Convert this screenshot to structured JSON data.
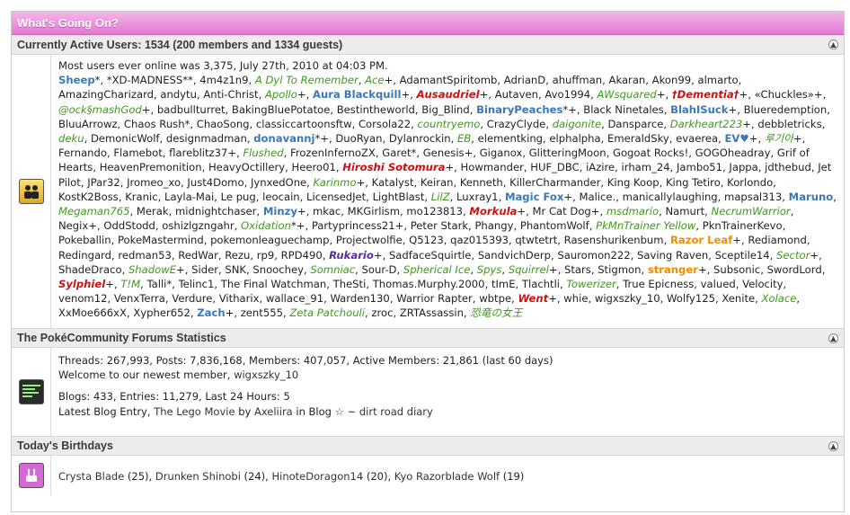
{
  "header": {
    "title": "What's Going On?"
  },
  "active_users": {
    "title": "Currently Active Users: 1534 (200 members and 1334 guests)",
    "record": "Most users ever online was 3,375, July 27th, 2010 at 04:03 PM.",
    "users": [
      {
        "n": "Sheep",
        "s": "*",
        "c": "blue"
      },
      {
        "n": "*XD-MADNESS**",
        "c": ""
      },
      {
        "n": "4m4z1n9",
        "c": ""
      },
      {
        "n": "A Dyl To Remember",
        "c": "green"
      },
      {
        "n": "Ace",
        "s": "+",
        "c": "green"
      },
      {
        "n": "AdamantSpiritomb",
        "c": ""
      },
      {
        "n": "AdrianD",
        "c": ""
      },
      {
        "n": "ahuffman",
        "c": ""
      },
      {
        "n": "Akaran",
        "c": ""
      },
      {
        "n": "Akon99",
        "c": ""
      },
      {
        "n": "almarto",
        "c": ""
      },
      {
        "n": "AmazingCharizard",
        "c": ""
      },
      {
        "n": "andytu",
        "c": ""
      },
      {
        "n": "Anti-Christ",
        "c": ""
      },
      {
        "n": "Apollo",
        "s": "+",
        "c": "green"
      },
      {
        "n": "Aura Blackquill",
        "s": "+",
        "c": "blue"
      },
      {
        "n": "Ausaudriel",
        "s": "+",
        "c": "red"
      },
      {
        "n": "Autaven",
        "c": ""
      },
      {
        "n": "Avo1994",
        "c": ""
      },
      {
        "n": "AWsquared",
        "s": "+",
        "c": "green"
      },
      {
        "n": "†Dementia†",
        "s": "+",
        "c": "red"
      },
      {
        "n": "«Chuckles»",
        "s": "+",
        "c": ""
      },
      {
        "n": "@ock§mashGod",
        "s": "+",
        "c": "green"
      },
      {
        "n": "badbullturret",
        "c": ""
      },
      {
        "n": "BakingBluePotatoe",
        "c": ""
      },
      {
        "n": "Bestintheworld",
        "c": ""
      },
      {
        "n": "Big_Blind",
        "c": ""
      },
      {
        "n": "BinaryPeaches",
        "s": "*+",
        "c": "blue"
      },
      {
        "n": "Black Ninetales",
        "c": ""
      },
      {
        "n": "BlahISuck",
        "s": "+",
        "c": "blue"
      },
      {
        "n": "Blueredemption",
        "c": ""
      },
      {
        "n": "BluuArrowz",
        "c": ""
      },
      {
        "n": "Chaos Rush",
        "s": "*",
        "c": ""
      },
      {
        "n": "ChaoSong",
        "c": ""
      },
      {
        "n": "classiccartoonsftw",
        "c": ""
      },
      {
        "n": "Corsola22",
        "c": ""
      },
      {
        "n": "countryemo",
        "c": "green"
      },
      {
        "n": "CrazyClyde",
        "c": ""
      },
      {
        "n": "daigonite",
        "c": "green"
      },
      {
        "n": "Dansparce",
        "c": ""
      },
      {
        "n": "Darkheart223",
        "s": "+",
        "c": "green"
      },
      {
        "n": "debbletricks",
        "c": ""
      },
      {
        "n": "deku",
        "c": "green"
      },
      {
        "n": "DemonicWolf",
        "c": ""
      },
      {
        "n": "designmadman",
        "c": ""
      },
      {
        "n": "donavannj",
        "s": "*+",
        "c": "blue"
      },
      {
        "n": "DuoRyan",
        "c": ""
      },
      {
        "n": "Dylanrockin",
        "c": ""
      },
      {
        "n": "EB",
        "c": "green"
      },
      {
        "n": "elementking",
        "c": ""
      },
      {
        "n": "elphalpha",
        "c": ""
      },
      {
        "n": "EmeraldSky",
        "c": ""
      },
      {
        "n": "evaerea",
        "c": ""
      },
      {
        "n": "EV♥",
        "s": "+",
        "c": "blue"
      },
      {
        "n": "루기아",
        "s": "+",
        "c": "green"
      },
      {
        "n": "Fernando",
        "c": ""
      },
      {
        "n": "Flamebot",
        "c": ""
      },
      {
        "n": "flareblitz37",
        "s": "+",
        "c": ""
      },
      {
        "n": "Flushed",
        "c": "green"
      },
      {
        "n": "FrozenInfernoZX",
        "c": ""
      },
      {
        "n": "Garet",
        "s": "*",
        "c": ""
      },
      {
        "n": "Genesis",
        "s": "+",
        "c": ""
      },
      {
        "n": "Giganox",
        "c": ""
      },
      {
        "n": "GlitteringMoon",
        "c": ""
      },
      {
        "n": "Gogoat Rocks!",
        "c": ""
      },
      {
        "n": "GOGOheadray",
        "c": ""
      },
      {
        "n": "Grif of Hearts",
        "c": ""
      },
      {
        "n": "HeavenPremonition",
        "c": ""
      },
      {
        "n": "HeavyOctillery",
        "c": ""
      },
      {
        "n": "Heero01",
        "c": ""
      },
      {
        "n": "Hiroshi Sotomura",
        "s": "+",
        "c": "red"
      },
      {
        "n": "Howmander",
        "c": ""
      },
      {
        "n": "HUF_DBC",
        "c": ""
      },
      {
        "n": "iAzire",
        "c": ""
      },
      {
        "n": "irham_24",
        "c": ""
      },
      {
        "n": "Jambo51",
        "c": ""
      },
      {
        "n": "Jappa",
        "c": ""
      },
      {
        "n": "jdthebud",
        "c": ""
      },
      {
        "n": "Jet Pilot",
        "c": ""
      },
      {
        "n": "JPar32",
        "c": ""
      },
      {
        "n": "Jromeo_xo",
        "c": ""
      },
      {
        "n": "Just4Domo",
        "c": ""
      },
      {
        "n": "JynxedOne",
        "c": ""
      },
      {
        "n": "Karinmo",
        "s": "+",
        "c": "green"
      },
      {
        "n": "Katalyst",
        "c": ""
      },
      {
        "n": "Keiran",
        "c": ""
      },
      {
        "n": "Kenneth",
        "c": ""
      },
      {
        "n": "KillerCharmander",
        "c": ""
      },
      {
        "n": "King Koop",
        "c": ""
      },
      {
        "n": "King Tetiro",
        "c": ""
      },
      {
        "n": "Korlondo",
        "c": ""
      },
      {
        "n": "KostK2Boss",
        "c": ""
      },
      {
        "n": "Kranic",
        "c": ""
      },
      {
        "n": "Layla-Mai",
        "c": ""
      },
      {
        "n": "Le pug",
        "c": ""
      },
      {
        "n": "leocain",
        "c": ""
      },
      {
        "n": "LicensedJet",
        "c": ""
      },
      {
        "n": "LightBlast",
        "c": ""
      },
      {
        "n": "LilZ",
        "c": "green"
      },
      {
        "n": "Luxray1",
        "c": ""
      },
      {
        "n": "Magic Fox",
        "s": "+",
        "c": "blue"
      },
      {
        "n": "Malice.",
        "c": ""
      },
      {
        "n": "manicallylaughing",
        "c": ""
      },
      {
        "n": "mapsal313",
        "c": ""
      },
      {
        "n": "Maruno",
        "c": "blue"
      },
      {
        "n": "Megaman765",
        "c": "green"
      },
      {
        "n": "Merak",
        "c": ""
      },
      {
        "n": "midnightchaser",
        "c": ""
      },
      {
        "n": "Minzy",
        "s": "+",
        "c": "blue"
      },
      {
        "n": "mkac",
        "c": ""
      },
      {
        "n": "MKGirlism",
        "c": ""
      },
      {
        "n": "mo123813",
        "c": ""
      },
      {
        "n": "Morkula",
        "s": "+",
        "c": "red"
      },
      {
        "n": "Mr Cat Dog",
        "s": "+",
        "c": ""
      },
      {
        "n": "msdmario",
        "c": "green"
      },
      {
        "n": "Namurt",
        "c": ""
      },
      {
        "n": "NecrumWarrior",
        "c": "green"
      },
      {
        "n": "Negix",
        "s": "+",
        "c": ""
      },
      {
        "n": "OddStodd",
        "c": ""
      },
      {
        "n": "oshizlgzngahr",
        "c": ""
      },
      {
        "n": "Oxidation",
        "s": "*+",
        "c": "green"
      },
      {
        "n": "Partyprincess21",
        "s": "+",
        "c": ""
      },
      {
        "n": "Peter Stark",
        "c": ""
      },
      {
        "n": "Phangy",
        "c": ""
      },
      {
        "n": "PhantomWolf",
        "c": ""
      },
      {
        "n": "PkMnTrainer Yellow",
        "c": "green"
      },
      {
        "n": "PknTrainerKevo",
        "c": ""
      },
      {
        "n": "Pokeballin",
        "c": ""
      },
      {
        "n": "PokeMastermind",
        "c": ""
      },
      {
        "n": "pokemonleaguechamp",
        "c": ""
      },
      {
        "n": "Projectwolfie",
        "c": ""
      },
      {
        "n": "Q5123",
        "c": ""
      },
      {
        "n": "qaz015393",
        "c": ""
      },
      {
        "n": "qtwtetrt",
        "c": ""
      },
      {
        "n": "Rasenshurikenbum",
        "c": ""
      },
      {
        "n": "Razor Leaf",
        "s": "+",
        "c": "orange"
      },
      {
        "n": "Rediamond",
        "c": ""
      },
      {
        "n": "Redingard",
        "c": ""
      },
      {
        "n": "redman53",
        "c": ""
      },
      {
        "n": "RedWar",
        "c": ""
      },
      {
        "n": "Rezu",
        "c": ""
      },
      {
        "n": "rp9",
        "c": ""
      },
      {
        "n": "RPD490",
        "c": ""
      },
      {
        "n": "Rukario",
        "s": "+",
        "c": "purple"
      },
      {
        "n": "SadfaceSquirtle",
        "c": ""
      },
      {
        "n": "SandvichDerp",
        "c": ""
      },
      {
        "n": "Sauromon222",
        "c": ""
      },
      {
        "n": "Saving Raven",
        "c": ""
      },
      {
        "n": "Sceptile14",
        "c": ""
      },
      {
        "n": "Sector",
        "s": "+",
        "c": "green"
      },
      {
        "n": "ShadeDraco",
        "c": ""
      },
      {
        "n": "ShadowE",
        "s": "+",
        "c": "green"
      },
      {
        "n": "Sider",
        "c": ""
      },
      {
        "n": "SNK",
        "c": ""
      },
      {
        "n": "Snoochey",
        "c": ""
      },
      {
        "n": "Somniac",
        "c": "green"
      },
      {
        "n": "Sour-D",
        "c": ""
      },
      {
        "n": "Spherical Ice",
        "c": "green"
      },
      {
        "n": "Spys",
        "c": "green"
      },
      {
        "n": "Squirrel",
        "s": "+",
        "c": "green"
      },
      {
        "n": "Stars",
        "c": ""
      },
      {
        "n": "Stigmon",
        "c": ""
      },
      {
        "n": "stranger",
        "s": "+",
        "c": "orange"
      },
      {
        "n": "Subsonic",
        "c": ""
      },
      {
        "n": "SwordLord",
        "c": ""
      },
      {
        "n": "Sylphiel",
        "s": "+",
        "c": "red"
      },
      {
        "n": "T!M",
        "c": "green"
      },
      {
        "n": "Talli",
        "s": "*",
        "c": ""
      },
      {
        "n": "Telinc1",
        "c": ""
      },
      {
        "n": "The Final Watchman",
        "c": ""
      },
      {
        "n": "TheSti",
        "c": ""
      },
      {
        "n": "Thomas.Murphy.2000",
        "c": ""
      },
      {
        "n": "tImE",
        "c": ""
      },
      {
        "n": "Tlachtli",
        "c": ""
      },
      {
        "n": "Towerizer",
        "c": "green"
      },
      {
        "n": "True Epicness",
        "c": ""
      },
      {
        "n": "valued",
        "c": ""
      },
      {
        "n": "Velocity",
        "c": ""
      },
      {
        "n": "venom12",
        "c": ""
      },
      {
        "n": "VenxTerra",
        "c": ""
      },
      {
        "n": "Verdure",
        "c": ""
      },
      {
        "n": "Vitharix",
        "c": ""
      },
      {
        "n": "wallace_91",
        "c": ""
      },
      {
        "n": "Warden130",
        "c": ""
      },
      {
        "n": "Warrior Rapter",
        "c": ""
      },
      {
        "n": "wbtpe",
        "c": ""
      },
      {
        "n": "Went",
        "s": "+",
        "c": "red"
      },
      {
        "n": "whie",
        "c": ""
      },
      {
        "n": "wigxszky_10",
        "c": ""
      },
      {
        "n": "Wolfy125",
        "c": ""
      },
      {
        "n": "Xenite",
        "c": ""
      },
      {
        "n": "Xolace",
        "c": "green"
      },
      {
        "n": "XxMoe666xX",
        "c": ""
      },
      {
        "n": "Xypher652",
        "c": ""
      },
      {
        "n": "Zach",
        "s": "+",
        "c": "blue"
      },
      {
        "n": "zent555",
        "c": ""
      },
      {
        "n": "Zeta Patchouli",
        "c": "green"
      },
      {
        "n": "zroc",
        "c": ""
      },
      {
        "n": "ZRTAssassin",
        "c": ""
      },
      {
        "n": "恐竜の女王",
        "c": "green",
        "last": true
      }
    ]
  },
  "stats": {
    "title": "The PokéCommunity Forums Statistics",
    "line1": "Threads: 267,993, Posts: 7,836,168, Members: 407,057, Active Members: 21,861 (last 60 days)",
    "welcome_prefix": "Welcome to our newest member,",
    "newest_member": "wigxszky_10",
    "blog_line": "Blogs: 433, Entries: 11,279, Last 24 Hours: 5",
    "latest_blog_prefix": "Latest Blog Entry,",
    "latest_blog_title": "The Lego Movie",
    "by": "by",
    "blog_author": "Axeliira",
    "in_blog": "in Blog",
    "blog_name": "☆ ~ dirt road diary"
  },
  "birthdays": {
    "title": "Today's Birthdays",
    "people": [
      {
        "name": "Crysta Blade",
        "age": "(25)"
      },
      {
        "name": "Drunken Shinobi",
        "age": "(24)"
      },
      {
        "name": "HinoteDoragon14",
        "age": "(20)"
      },
      {
        "name": "Kyo Razorblade Wolf",
        "age": "(19)"
      }
    ]
  }
}
